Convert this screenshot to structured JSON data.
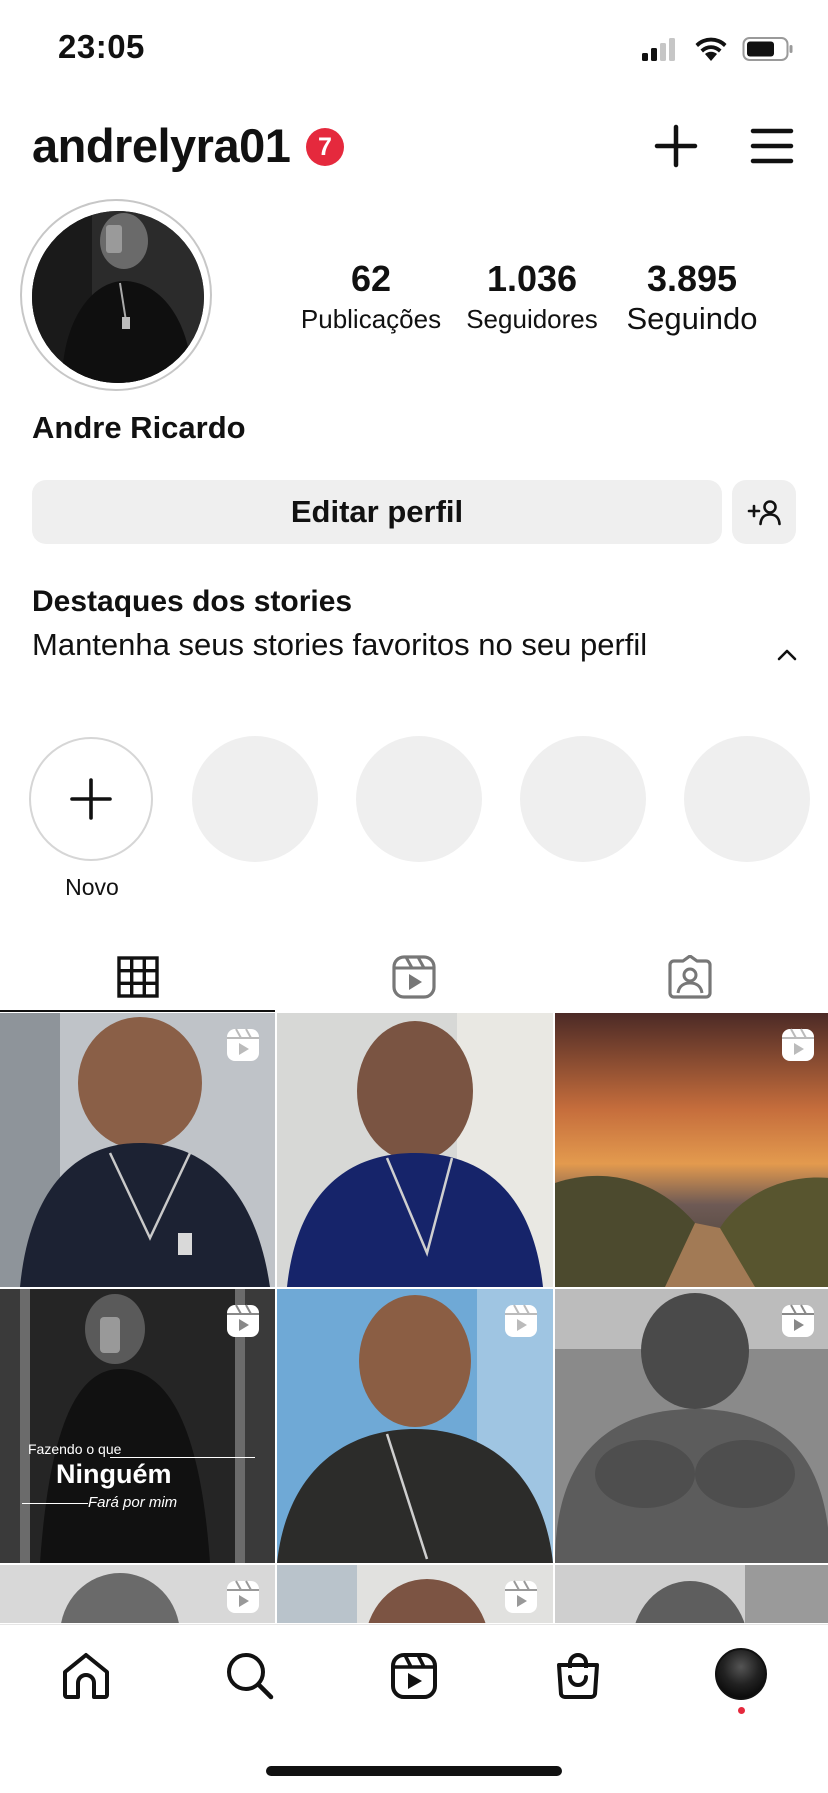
{
  "status_bar": {
    "time": "23:05",
    "icons": [
      "signal-icon",
      "wifi-icon",
      "battery-icon"
    ]
  },
  "header": {
    "username": "andrelyra01",
    "notification_count": "7",
    "create_icon": "plus-icon",
    "menu_icon": "hamburger-menu-icon"
  },
  "profile": {
    "display_name": "Andre Ricardo",
    "stats": [
      {
        "value": "62",
        "label": "Publicações"
      },
      {
        "value": "1.036",
        "label": "Seguidores"
      },
      {
        "value": "3.895",
        "label": "Seguindo"
      }
    ]
  },
  "actions": {
    "edit_profile": "Editar perfil",
    "discover_people_icon": "add-person-icon"
  },
  "highlights": {
    "title": "Destaques dos stories",
    "description": "Mantenha seus stories favoritos no seu perfil",
    "new_label": "Novo"
  },
  "tabs": [
    "grid-icon",
    "reels-icon",
    "tagged-icon"
  ],
  "grid": {
    "caption_top": "Fazendo o que",
    "caption_main": "Ninguém",
    "caption_bottom": "Fará por mim"
  },
  "bottom_nav": [
    "home-icon",
    "search-icon",
    "reels-icon",
    "shop-icon",
    "profile-avatar"
  ],
  "colors": {
    "badge": "#e5293d",
    "button_bg": "#efefef",
    "text": "#111111"
  }
}
